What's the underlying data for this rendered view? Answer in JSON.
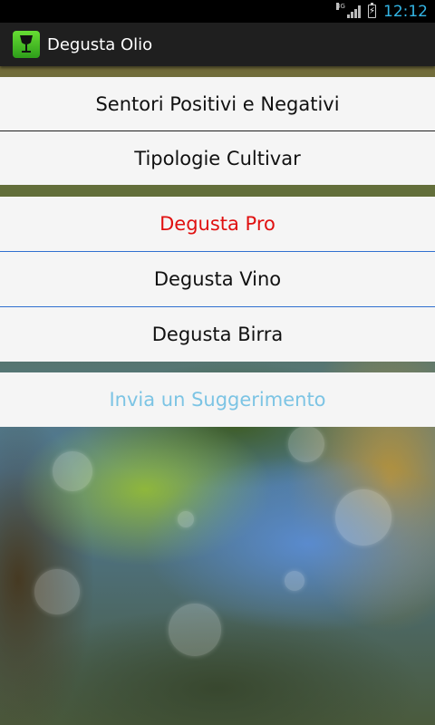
{
  "status_bar": {
    "network_type": "3G",
    "time": "12:12",
    "icons": [
      "signal-icon",
      "battery-charging-icon"
    ]
  },
  "action_bar": {
    "app_title": "Degusta Olio",
    "icon": "wine-glass-icon"
  },
  "menu": {
    "items": [
      {
        "label": "Sentori Positivi e Negativi",
        "color": "#111111"
      },
      {
        "label": "Tipologie Cultivar",
        "color": "#111111"
      },
      {
        "label": "Degusta Pro",
        "color": "#e01010"
      },
      {
        "label": "Degusta Vino",
        "color": "#111111"
      },
      {
        "label": "Degusta Birra",
        "color": "#111111"
      },
      {
        "label": "Invia un Suggerimento",
        "color": "#7cc4e4"
      }
    ]
  },
  "colors": {
    "accent_holo_blue": "#33b5e5",
    "divider_blue": "#3070d0"
  }
}
